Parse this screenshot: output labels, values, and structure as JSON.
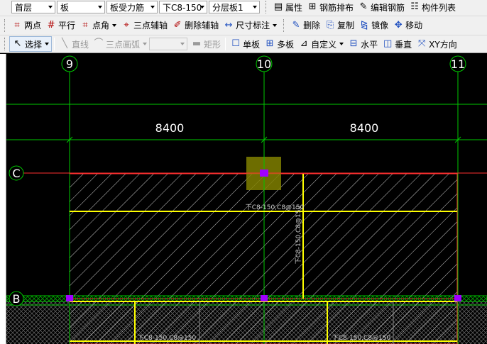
{
  "toolbar1": {
    "floor_select": "首层",
    "type_select": "板",
    "subtype_select": "板受力筋",
    "rebar_select": "下C8-150",
    "layer_select": "分层板1",
    "btn_properties": "属性",
    "btn_rebar_arrange": "钢筋排布",
    "btn_edit_rebar": "编辑钢筋",
    "btn_component_list": "构件列表"
  },
  "toolbar2": {
    "btn_two_points": "两点",
    "btn_parallel": "平行",
    "btn_point_angle": "点角",
    "btn_three_point_axis": "三点辅轴",
    "btn_delete_axis": "删除辅轴",
    "btn_dimension": "尺寸标注",
    "btn_delete": "删除",
    "btn_copy": "复制",
    "btn_mirror": "镜像",
    "btn_move": "移动"
  },
  "toolbar3": {
    "btn_select": "选择",
    "btn_line": "直线",
    "btn_three_point_arc": "三点画弧",
    "btn_rectangle": "矩形",
    "btn_single_slab": "单板",
    "btn_multi_slab": "多板",
    "btn_custom": "自定义",
    "btn_horizontal": "水平",
    "btn_vertical": "垂直",
    "btn_xy_direction": "XY方向"
  },
  "drawing": {
    "axis_9": "9",
    "axis_10": "10",
    "axis_11": "11",
    "axis_C": "C",
    "axis_B": "B",
    "dim_left": "8400",
    "dim_right": "8400",
    "rebar_label_horizontal": "下C8-150,C8@150",
    "rebar_label_vertical": "下C8-150,C8@150",
    "rebar_label_bottom_left": "下C8-150,C8@150",
    "rebar_label_bottom_right": "下C8-150,C8@150"
  },
  "colors": {
    "axis_line": "#00c800",
    "slab_border": "#ff3030",
    "rebar_line": "#ffff00",
    "hatch": "#c8c8c8",
    "grip_point": "#a000ff",
    "selection_box": "#808000"
  }
}
